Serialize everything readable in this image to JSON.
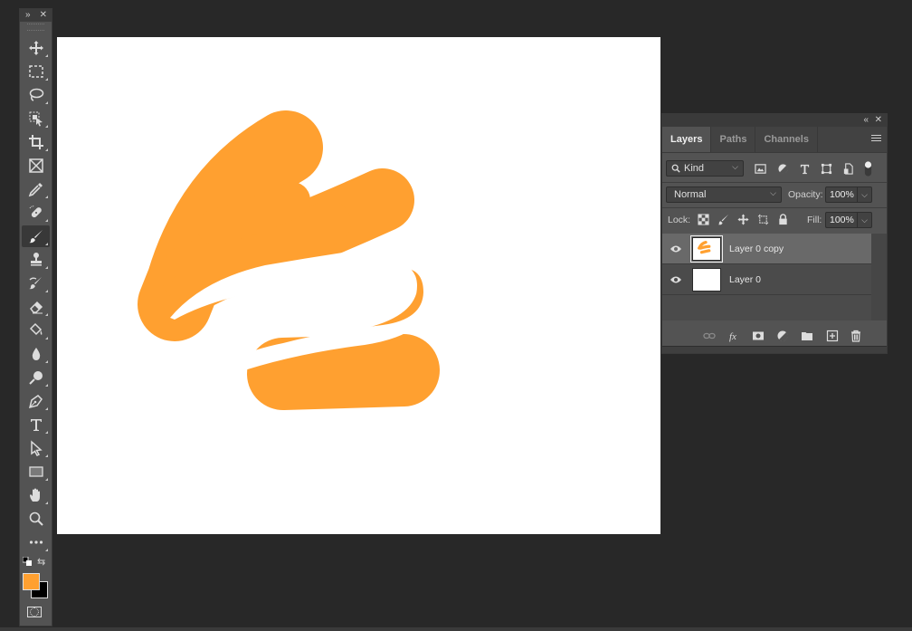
{
  "toolbar": {
    "collapse_label": "»",
    "close_label": "✕",
    "tools": [
      {
        "name": "move-tool",
        "icon": "move-icon"
      },
      {
        "name": "rectangular-marquee-tool",
        "icon": "marquee-icon"
      },
      {
        "name": "lasso-tool",
        "icon": "lasso-icon"
      },
      {
        "name": "object-selection-tool",
        "icon": "object-selection-icon"
      },
      {
        "name": "crop-tool",
        "icon": "crop-icon"
      },
      {
        "name": "frame-tool",
        "icon": "frame-icon"
      },
      {
        "name": "eyedropper-tool",
        "icon": "eyedropper-icon"
      },
      {
        "name": "spot-healing-brush-tool",
        "icon": "bandage-icon"
      },
      {
        "name": "brush-tool",
        "icon": "brush-icon",
        "active": true
      },
      {
        "name": "clone-stamp-tool",
        "icon": "stamp-icon"
      },
      {
        "name": "history-brush-tool",
        "icon": "history-brush-icon"
      },
      {
        "name": "eraser-tool",
        "icon": "eraser-icon"
      },
      {
        "name": "paint-bucket-tool",
        "icon": "paint-bucket-icon"
      },
      {
        "name": "blur-tool",
        "icon": "drop-icon"
      },
      {
        "name": "dodge-tool",
        "icon": "dodge-icon"
      },
      {
        "name": "pen-tool",
        "icon": "pen-icon"
      },
      {
        "name": "type-tool",
        "icon": "type-icon"
      },
      {
        "name": "path-selection-tool",
        "icon": "arrow-icon"
      },
      {
        "name": "rectangle-tool",
        "icon": "rectangle-icon"
      },
      {
        "name": "hand-tool",
        "icon": "hand-icon"
      },
      {
        "name": "zoom-tool",
        "icon": "zoom-icon"
      },
      {
        "name": "edit-toolbar",
        "icon": "more-icon"
      }
    ],
    "foreground_color": "#ffa030",
    "background_color": "#000000",
    "swap_label": "⇆"
  },
  "canvas": {
    "background": "#ffffff",
    "stroke_color": "#ffa030"
  },
  "layers_panel": {
    "collapse_label": "«",
    "close_label": "✕",
    "tabs": [
      {
        "label": "Layers",
        "active": true
      },
      {
        "label": "Paths",
        "active": false
      },
      {
        "label": "Channels",
        "active": false
      }
    ],
    "filter": {
      "value": "Kind"
    },
    "blend_mode": {
      "value": "Normal"
    },
    "opacity": {
      "label": "Opacity:",
      "value": "100%"
    },
    "lock": {
      "label": "Lock:"
    },
    "fill": {
      "label": "Fill:",
      "value": "100%"
    },
    "layers": [
      {
        "name": "Layer 0 copy",
        "visible": true,
        "selected": true
      },
      {
        "name": "Layer 0",
        "visible": true,
        "selected": false
      }
    ],
    "chevron": "⌵"
  }
}
